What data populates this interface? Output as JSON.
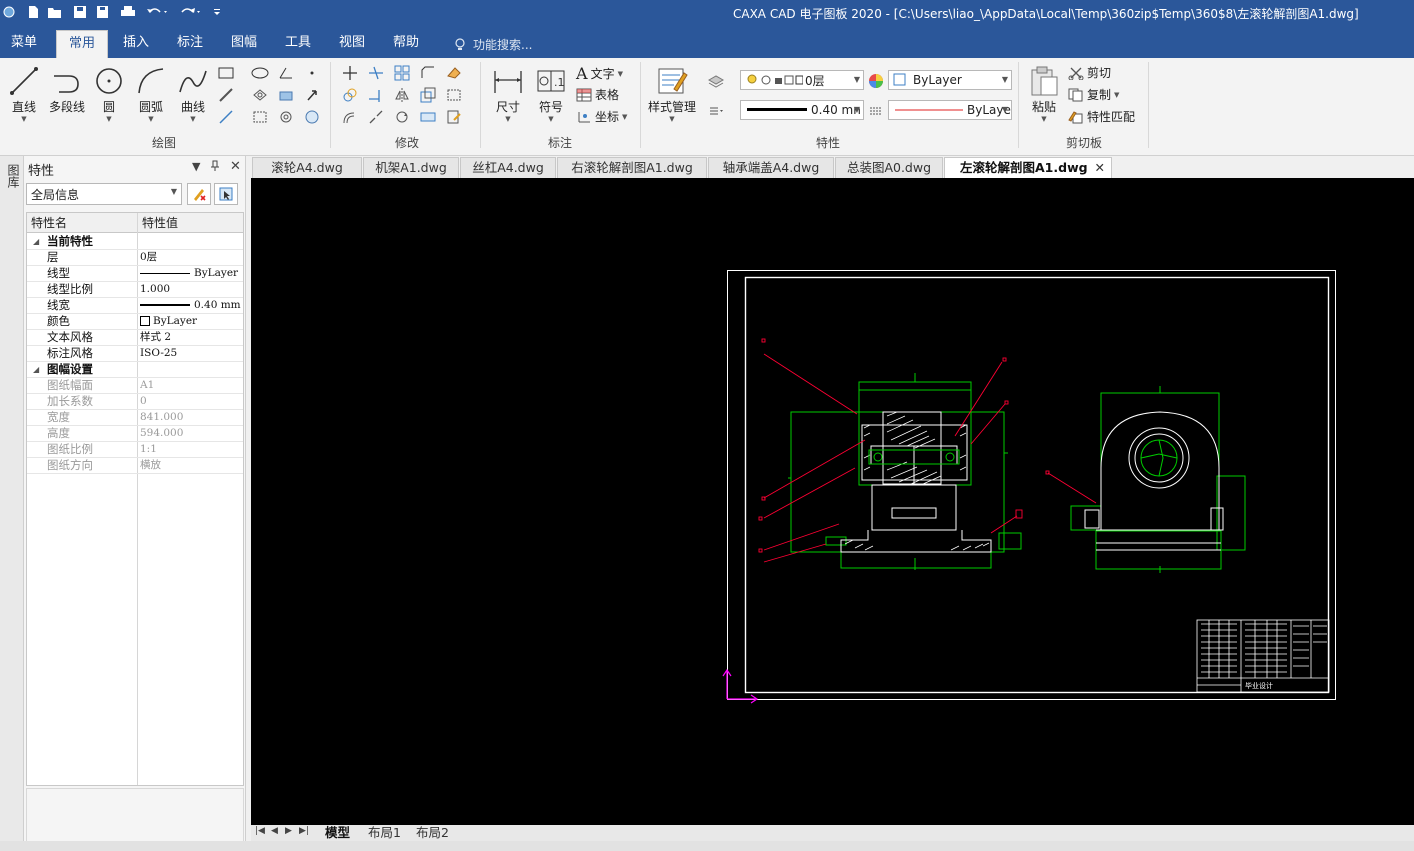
{
  "window": {
    "title": "CAXA CAD 电子图板 2020 - [C:\\Users\\liao_\\AppData\\Local\\Temp\\360zip$Temp\\360$8\\左滚轮解剖图A1.dwg]"
  },
  "quick_access": [
    "app-logo-icon",
    "new-file-icon",
    "open-file-icon",
    "save-icon",
    "save-as-icon",
    "print-icon",
    "undo-icon",
    "redo-icon",
    "customize-icon"
  ],
  "menu": {
    "tabs": [
      "菜单",
      "常用",
      "插入",
      "标注",
      "图幅",
      "工具",
      "视图",
      "帮助"
    ],
    "active": "常用",
    "search_placeholder": "功能搜索..."
  },
  "ribbon": {
    "draw": {
      "label": "绘图",
      "line": "直线",
      "polyline": "多段线",
      "circle": "圆",
      "arc": "圆弧",
      "curve": "曲线"
    },
    "modify": {
      "label": "修改"
    },
    "annotate": {
      "label": "标注",
      "dimension": "尺寸",
      "symbol": "符号",
      "text": "文字",
      "table": "表格",
      "coordinate": "坐标"
    },
    "properties": {
      "label": "特性",
      "style_manager": "样式管理",
      "layer": "0层",
      "color": "ByLayer",
      "lineweight": "0.40 mn",
      "linetype": "ByLaye"
    },
    "clipboard": {
      "label": "剪切板",
      "paste": "粘贴",
      "cut": "剪切",
      "copy": "复制",
      "match": "特性匹配"
    }
  },
  "left_strip": {
    "label": "图库"
  },
  "panel": {
    "title": "特性",
    "scope": "全局信息",
    "col_name": "特性名",
    "col_value": "特性值",
    "rows": [
      {
        "type": "cat",
        "name": "当前特性"
      },
      {
        "type": "prop",
        "name": "层",
        "value": "0层"
      },
      {
        "type": "prop",
        "name": "线型",
        "value": "ByLayer"
      },
      {
        "type": "prop",
        "name": "线型比例",
        "value": "1.000"
      },
      {
        "type": "prop",
        "name": "线宽",
        "value": "0.40 mm"
      },
      {
        "type": "prop",
        "name": "颜色",
        "value": "ByLayer"
      },
      {
        "type": "prop",
        "name": "文本风格",
        "value": "样式 2"
      },
      {
        "type": "prop",
        "name": "标注风格",
        "value": "ISO-25"
      },
      {
        "type": "cat",
        "name": "图幅设置"
      },
      {
        "type": "dis",
        "name": "图纸幅面",
        "value": "A1"
      },
      {
        "type": "dis",
        "name": "加长系数",
        "value": "0"
      },
      {
        "type": "dis",
        "name": "宽度",
        "value": "841.000"
      },
      {
        "type": "dis",
        "name": "高度",
        "value": "594.000"
      },
      {
        "type": "dis",
        "name": "图纸比例",
        "value": "1:1"
      },
      {
        "type": "dis",
        "name": "图纸方向",
        "value": "横放"
      }
    ]
  },
  "doc_tabs": [
    "滚轮A4.dwg",
    "机架A1.dwg",
    "丝杠A4.dwg",
    "右滚轮解剖图A1.dwg",
    "轴承端盖A4.dwg",
    "总装图A0.dwg",
    "左滚轮解剖图A1.dwg"
  ],
  "active_doc": "左滚轮解剖图A1.dwg",
  "drawing": {
    "title_block_text": "毕业设计"
  },
  "layout_tabs": [
    "模型",
    "布局1",
    "布局2"
  ],
  "colors": {
    "ribbon_blue": "#2b579a",
    "canvas": "#000000",
    "cad_green": "#00cc00",
    "cad_red": "#ff0033",
    "cad_white": "#ffffff",
    "cad_magenta": "#ff00ff"
  }
}
